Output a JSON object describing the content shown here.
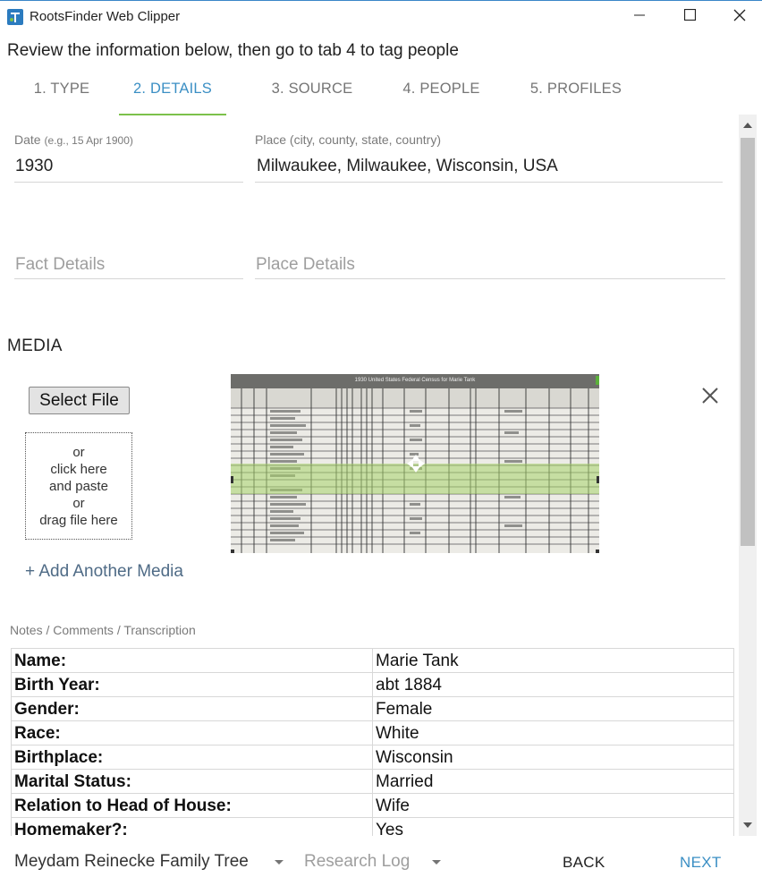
{
  "window": {
    "title": "RootsFinder Web Clipper"
  },
  "instruction": "Review the information below, then go to tab 4 to tag people",
  "tabs": [
    {
      "label": "1. TYPE",
      "active": false
    },
    {
      "label": "2. DETAILS",
      "active": true
    },
    {
      "label": "3. SOURCE",
      "active": false
    },
    {
      "label": "4. PEOPLE",
      "active": false
    },
    {
      "label": "5. PROFILES",
      "active": false
    }
  ],
  "fields": {
    "date": {
      "label": "Date",
      "hint": "(e.g., 15 Apr 1900)",
      "value": "1930"
    },
    "place": {
      "label": "Place (city, county, state, country)",
      "value": "Milwaukee, Milwaukee, Wisconsin, USA"
    },
    "fact_details": {
      "placeholder": "Fact Details"
    },
    "place_details": {
      "placeholder": "Place Details"
    }
  },
  "media": {
    "heading": "MEDIA",
    "select_file": "Select File",
    "dropzone_lines": [
      "or",
      "click here",
      "and paste",
      "or",
      "drag file here"
    ],
    "add_another": "+ Add Another Media",
    "thumbnail_caption": "1930 United States Federal Census for Marie Tank"
  },
  "notes": {
    "label": "Notes / Comments / Transcription",
    "rows": [
      {
        "key": "Name:",
        "value": "Marie Tank"
      },
      {
        "key": "Birth Year:",
        "value": "abt 1884"
      },
      {
        "key": "Gender:",
        "value": "Female"
      },
      {
        "key": "Race:",
        "value": "White"
      },
      {
        "key": "Birthplace:",
        "value": "Wisconsin"
      },
      {
        "key": "Marital Status:",
        "value": "Married"
      },
      {
        "key": "Relation to Head of House:",
        "value": "Wife"
      },
      {
        "key": "Homemaker?:",
        "value": "Yes"
      }
    ]
  },
  "footer": {
    "tree_select": "Meydam Reinecke Family Tree",
    "log_select": "Research Log",
    "back": "BACK",
    "next": "NEXT"
  },
  "colors": {
    "accent": "#3b8fc4",
    "tab_indicator": "#7cc14a",
    "link": "#4f6b86"
  },
  "icons": [
    "app-logo-icon",
    "minimize-icon",
    "maximize-icon",
    "close-icon",
    "remove-media-icon",
    "chevron-down-icon",
    "scroll-up-icon",
    "scroll-down-icon"
  ]
}
